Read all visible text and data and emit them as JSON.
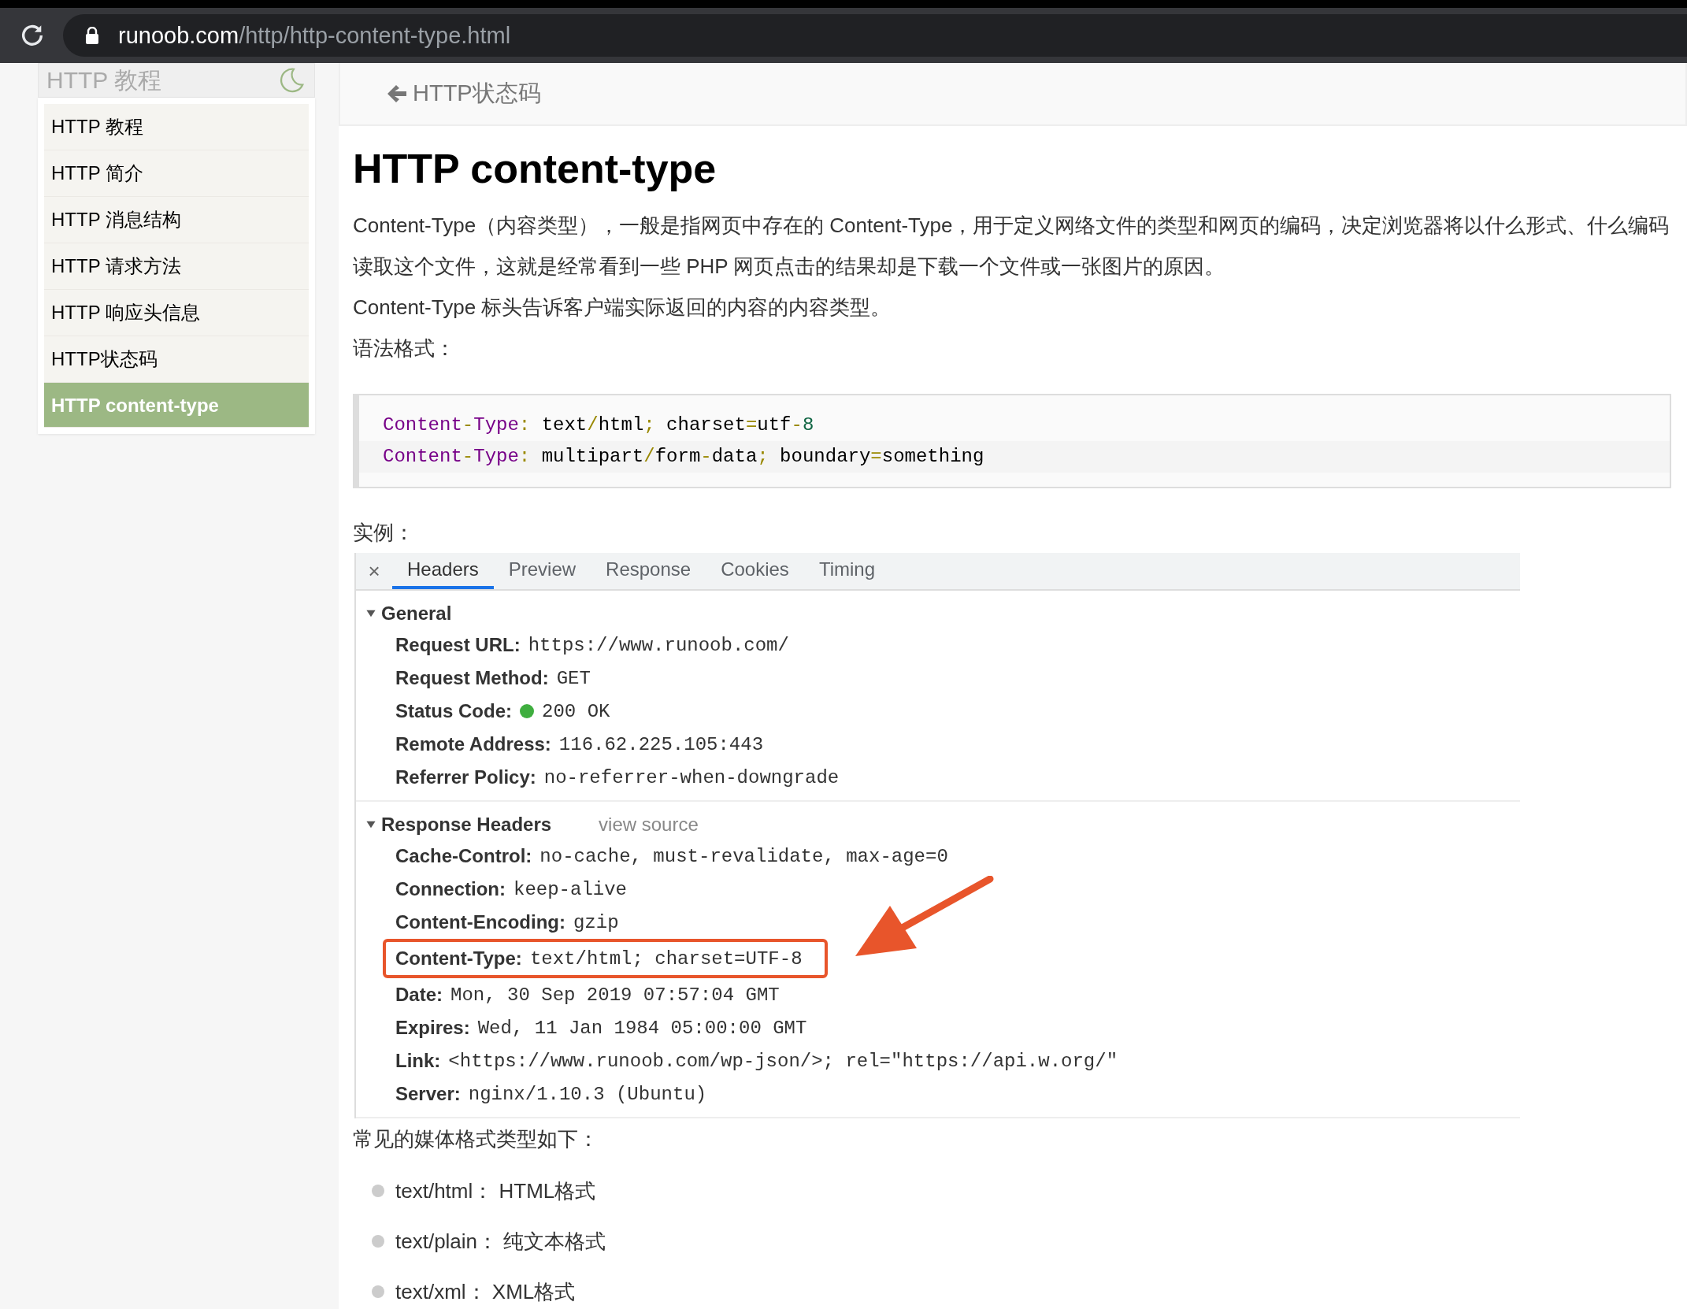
{
  "browser": {
    "url_host": "runoob.com",
    "url_path": "/http/http-content-type.html"
  },
  "sidebar": {
    "title": "HTTP 教程",
    "items": [
      {
        "label": "HTTP 教程",
        "selected": false
      },
      {
        "label": "HTTP 简介",
        "selected": false
      },
      {
        "label": "HTTP 消息结构",
        "selected": false
      },
      {
        "label": "HTTP 请求方法",
        "selected": false
      },
      {
        "label": "HTTP 响应头信息",
        "selected": false
      },
      {
        "label": "HTTP状态码",
        "selected": false
      },
      {
        "label": "HTTP content-type",
        "selected": true
      }
    ]
  },
  "breadcrumb": {
    "label": "HTTP状态码"
  },
  "article": {
    "title": "HTTP content-type",
    "paragraphs": [
      "Content-Type（内容类型），一般是指网页中存在的 Content-Type，用于定义网络文件的类型和网页的编码，决定浏览器将以什么形式、什么编码读取这个文件，这就是经常看到一些 PHP 网页点击的结果却是下载一个文件或一张图片的原因。",
      "Content-Type 标头告诉客户端实际返回的内容的内容类型。",
      "语法格式："
    ],
    "code_lines": [
      [
        {
          "kind": "key",
          "text": "Content"
        },
        {
          "kind": "punct",
          "text": "-"
        },
        {
          "kind": "key",
          "text": "Type"
        },
        {
          "kind": "punct",
          "text": ":"
        },
        {
          "kind": "plain",
          "text": " text"
        },
        {
          "kind": "punct",
          "text": "/"
        },
        {
          "kind": "plain",
          "text": "html"
        },
        {
          "kind": "punct",
          "text": ";"
        },
        {
          "kind": "plain",
          "text": " charset"
        },
        {
          "kind": "punct",
          "text": "="
        },
        {
          "kind": "plain",
          "text": "utf"
        },
        {
          "kind": "punct",
          "text": "-"
        },
        {
          "kind": "number",
          "text": "8"
        }
      ],
      [
        {
          "kind": "key",
          "text": "Content"
        },
        {
          "kind": "punct",
          "text": "-"
        },
        {
          "kind": "key",
          "text": "Type"
        },
        {
          "kind": "punct",
          "text": ":"
        },
        {
          "kind": "plain",
          "text": " multipart"
        },
        {
          "kind": "punct",
          "text": "/"
        },
        {
          "kind": "plain",
          "text": "form"
        },
        {
          "kind": "punct",
          "text": "-"
        },
        {
          "kind": "plain",
          "text": "data"
        },
        {
          "kind": "punct",
          "text": ";"
        },
        {
          "kind": "plain",
          "text": " boundary"
        },
        {
          "kind": "punct",
          "text": "="
        },
        {
          "kind": "plain",
          "text": "something"
        }
      ]
    ],
    "example_label": "实例：",
    "devtools": {
      "close": "×",
      "tabs": [
        {
          "label": "Headers",
          "selected": true
        },
        {
          "label": "Preview",
          "selected": false
        },
        {
          "label": "Response",
          "selected": false
        },
        {
          "label": "Cookies",
          "selected": false
        },
        {
          "label": "Timing",
          "selected": false
        }
      ],
      "sections": [
        {
          "title": "General",
          "expanded": true,
          "rows": [
            {
              "name": "Request URL:",
              "value": "https://www.runoob.com/",
              "kind": "plain",
              "highlighted": false
            },
            {
              "name": "Request Method:",
              "value": "GET",
              "kind": "plain",
              "highlighted": false
            },
            {
              "name": "Status Code:",
              "value": "200 OK",
              "kind": "status",
              "highlighted": false
            },
            {
              "name": "Remote Address:",
              "value": "116.62.225.105:443",
              "kind": "plain",
              "highlighted": false
            },
            {
              "name": "Referrer Policy:",
              "value": "no-referrer-when-downgrade",
              "kind": "plain",
              "highlighted": false
            }
          ]
        },
        {
          "title": "Response Headers",
          "link": "view source",
          "expanded": true,
          "rows": [
            {
              "name": "Cache-Control:",
              "value": "no-cache, must-revalidate, max-age=0",
              "kind": "plain",
              "highlighted": false
            },
            {
              "name": "Connection:",
              "value": "keep-alive",
              "kind": "plain",
              "highlighted": false
            },
            {
              "name": "Content-Encoding:",
              "value": "gzip",
              "kind": "plain",
              "highlighted": false
            },
            {
              "name": "Content-Type:",
              "value": "text/html; charset=UTF-8",
              "kind": "plain",
              "highlighted": true
            },
            {
              "name": "Date:",
              "value": "Mon, 30 Sep 2019 07:57:04 GMT",
              "kind": "plain",
              "highlighted": false
            },
            {
              "name": "Expires:",
              "value": "Wed, 11 Jan 1984 05:00:00 GMT",
              "kind": "plain",
              "highlighted": false
            },
            {
              "name": "Link:",
              "value": "<https://www.runoob.com/wp-json/>; rel=\"https://api.w.org/\"",
              "kind": "plain",
              "highlighted": false
            },
            {
              "name": "Server:",
              "value": "nginx/1.10.3 (Ubuntu)",
              "kind": "plain",
              "highlighted": false
            }
          ]
        }
      ]
    },
    "media_label": "常见的媒体格式类型如下：",
    "media_types": [
      "text/html：  HTML格式",
      "text/plain： 纯文本格式",
      "text/xml：  XML格式"
    ]
  }
}
